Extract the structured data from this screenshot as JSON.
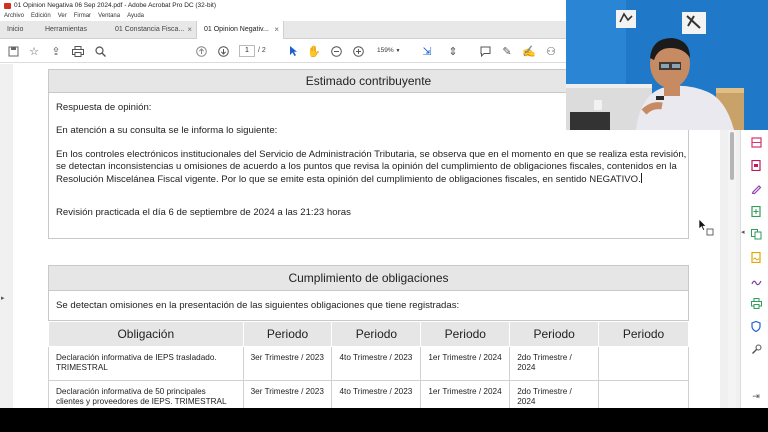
{
  "window": {
    "title": "01 Opinion Negativa 06 Sep 2024.pdf - Adobe Acrobat Pro DC (32-bit)",
    "menu": [
      "Archivo",
      "Edición",
      "Ver",
      "Firmar",
      "Ventana",
      "Ayuda"
    ]
  },
  "tabs": [
    {
      "label": "Inicio"
    },
    {
      "label": "Herramientas"
    },
    {
      "label": "01 Constancia Fisca...",
      "close": "×"
    },
    {
      "label": "01 Opinion Negativ...",
      "close": "×",
      "active": true
    }
  ],
  "toolbar": {
    "page_current": "1",
    "page_total": "/ 2",
    "zoom": "159%",
    "icons": [
      "save-icon",
      "star-icon",
      "upload-icon",
      "print-icon",
      "search-icon",
      "page-up-icon",
      "page-down-icon",
      "select-arrow-icon",
      "hand-icon",
      "zoom-out-icon",
      "zoom-in-icon",
      "fit-icon",
      "scroll-icon",
      "comment-icon",
      "pen-icon",
      "sign-icon",
      "share-icon"
    ]
  },
  "document": {
    "section1_title": "Estimado contribuyente",
    "line_respuesta": "Respuesta de opinión:",
    "line_atencion": "En atención a su consulta se le informa lo siguiente:",
    "para1": "En los controles electrónicos institucionales del Servicio de Administración Tributaria, se observa que en el momento en que se realiza esta revisión,",
    "para2": "se detectan inconsistencias u omisiones de acuerdo a los puntos que revisa la opinión del cumplimiento de obligaciones fiscales, contenidos en la",
    "para3": "Resolución Miscelánea Fiscal vigente. Por lo que se emite esta opinión del cumplimiento de obligaciones fiscales, en sentido NEGATIVO.",
    "revision": "Revisión practicada el día 6 de septiembre de 2024 a las 21:23 horas",
    "section2_title": "Cumplimiento de obligaciones",
    "omisiones": "Se detectan omisiones en la presentación de las siguientes obligaciones que tiene registradas:",
    "table": {
      "headers": [
        "Obligación",
        "Periodo",
        "Periodo",
        "Periodo",
        "Periodo",
        "Periodo"
      ],
      "rows": [
        [
          "Declaración informativa de IEPS trasladado. TRIMESTRAL",
          "3er Trimestre / 2023",
          "4to Trimestre / 2023",
          "1er Trimestre / 2024",
          "2do Trimestre / 2024",
          ""
        ],
        [
          "Declaración informativa de 50 principales clientes y proveedores de IEPS. TRIMESTRAL",
          "3er Trimestre / 2023",
          "4to Trimestre / 2023",
          "1er Trimestre / 2024",
          "2do Trimestre / 2024",
          ""
        ]
      ]
    }
  },
  "right_panel": {
    "icons": [
      {
        "name": "organize-pages-icon",
        "color": "#d6336c"
      },
      {
        "name": "export-pdf-icon",
        "color": "#c2185b"
      },
      {
        "name": "edit-pdf-icon",
        "color": "#8e44ad"
      },
      {
        "name": "create-pdf-icon",
        "color": "#2e9e5b"
      },
      {
        "name": "combine-icon",
        "color": "#2e9e5b"
      },
      {
        "name": "request-signature-icon",
        "color": "#e0a800"
      },
      {
        "name": "fill-sign-icon",
        "color": "#7b3fa0"
      },
      {
        "name": "print-production-icon",
        "color": "#2e9e5b"
      },
      {
        "name": "protect-icon",
        "color": "#1d5fd6"
      },
      {
        "name": "more-tools-icon",
        "color": "#555555"
      }
    ]
  },
  "colors": {
    "accent": "#1d5fd6",
    "header_gray": "#e6e6e6",
    "webcam_wall": "#1f78c8"
  }
}
